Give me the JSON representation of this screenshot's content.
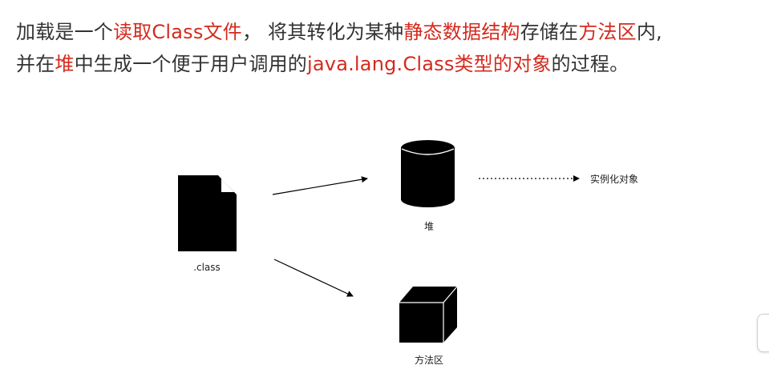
{
  "paragraph": {
    "line1": [
      {
        "text": "加载是一个",
        "hl": false
      },
      {
        "text": "读取Class文件",
        "hl": true
      },
      {
        "text": "， 将其转化为某种",
        "hl": false
      },
      {
        "text": "静态数据结构",
        "hl": true
      },
      {
        "text": "存储在",
        "hl": false
      },
      {
        "text": "方法区",
        "hl": true
      },
      {
        "text": "内,",
        "hl": false
      }
    ],
    "line2": [
      {
        "text": "并在",
        "hl": false
      },
      {
        "text": "堆",
        "hl": true
      },
      {
        "text": "中生成一个便于用户调用的",
        "hl": false
      },
      {
        "text": "java.lang.Class类型的对象",
        "hl": true
      },
      {
        "text": "的过程。",
        "hl": false
      }
    ]
  },
  "diagram": {
    "class_file_label": ".class",
    "heap_label": "堆",
    "method_area_label": "方法区",
    "instance_label": "实例化对象"
  },
  "colors": {
    "text": "#333333",
    "highlight": "#d42a1e",
    "shape": "#000000"
  }
}
